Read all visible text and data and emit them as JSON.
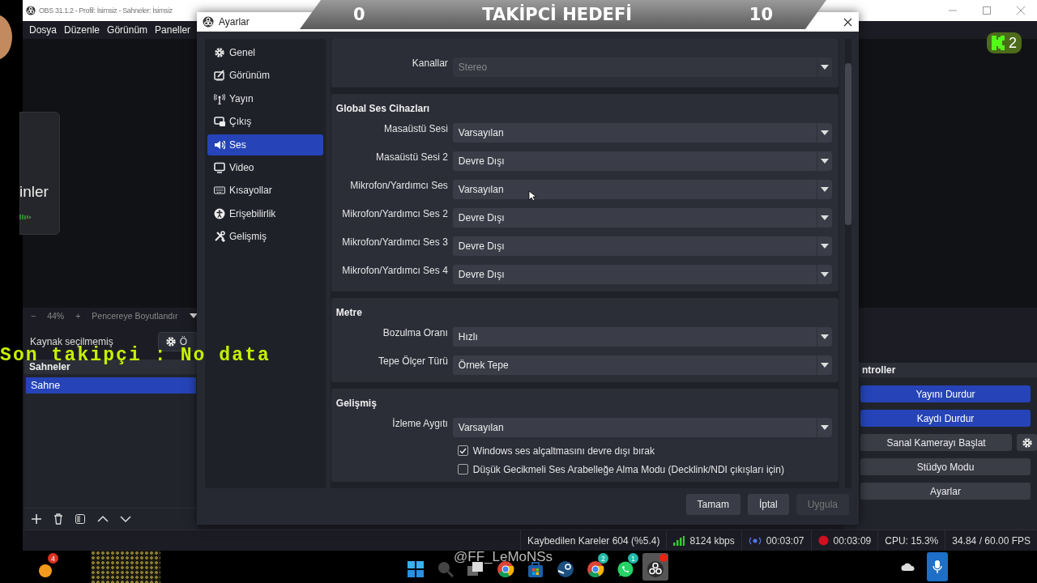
{
  "main_window": {
    "title": "OBS 31.1.2 - Profil: İsimsiz - Sahneler: İsimsiz",
    "menu": [
      "Dosya",
      "Düzenle",
      "Görünüm",
      "Paneller"
    ],
    "zoom_bar": {
      "minus": "−",
      "zoom": "44%",
      "plus": "+",
      "fit": "Pencereye Boyutlandır"
    },
    "source_bar": {
      "text": "Kaynak seçilmemiş",
      "button": "Ö"
    },
    "scenes": {
      "title": "Sahneler",
      "items": [
        {
          "label": "Sahne",
          "selected": true
        }
      ]
    },
    "controls": {
      "title": "ntroller",
      "buttons": [
        {
          "label": "Yayını Durdur",
          "active": true
        },
        {
          "label": "Kaydı Durdur",
          "active": true
        },
        {
          "label": "Sanal Kamerayı Başlat",
          "active": false
        },
        {
          "label": "Stüdyo Modu",
          "active": false
        },
        {
          "label": "Ayarlar",
          "active": false
        }
      ]
    },
    "status_bar": [
      {
        "kind": "plain",
        "text": "Kaybedilen Kareler 604 (%5.4)"
      },
      {
        "kind": "signal",
        "text": "8124 kbps"
      },
      {
        "kind": "stream",
        "text": "00:03:07"
      },
      {
        "kind": "record",
        "text": "00:03:09"
      },
      {
        "kind": "plain",
        "text": "CPU: 15.3%"
      },
      {
        "kind": "plain",
        "text": "34.84 / 60.00 FPS"
      }
    ]
  },
  "dialog": {
    "title": "Ayarlar",
    "nav": [
      {
        "kind": "gear",
        "label": "Genel",
        "selected": false
      },
      {
        "kind": "appearance",
        "label": "Görünüm",
        "selected": false
      },
      {
        "kind": "antenna",
        "label": "Yayın",
        "selected": false
      },
      {
        "kind": "output",
        "label": "Çıkış",
        "selected": false
      },
      {
        "kind": "speaker",
        "label": "Ses",
        "selected": true
      },
      {
        "kind": "monitor",
        "label": "Video",
        "selected": false
      },
      {
        "kind": "keyboard",
        "label": "Kısayollar",
        "selected": false
      },
      {
        "kind": "accessibility",
        "label": "Erişebilirlik",
        "selected": false
      },
      {
        "kind": "tools",
        "label": "Gelişmiş",
        "selected": false
      }
    ],
    "sections": [
      {
        "rows": [
          {
            "kind": "select",
            "label": "Kanallar",
            "value": "Stereo",
            "disabled": true
          }
        ]
      },
      {
        "title": "Global Ses Cihazları",
        "rows": [
          {
            "kind": "select",
            "label": "Masaüstü Sesi",
            "value": "Varsayılan",
            "disabled": false
          },
          {
            "kind": "select",
            "label": "Masaüstü Sesi 2",
            "value": "Devre Dışı",
            "disabled": false
          },
          {
            "kind": "select",
            "label": "Mikrofon/Yardımcı Ses",
            "value": "Varsayılan",
            "disabled": false
          },
          {
            "kind": "select",
            "label": "Mikrofon/Yardımcı Ses 2",
            "value": "Devre Dışı",
            "disabled": false
          },
          {
            "kind": "select",
            "label": "Mikrofon/Yardımcı Ses 3",
            "value": "Devre Dışı",
            "disabled": false
          },
          {
            "kind": "select",
            "label": "Mikrofon/Yardımcı Ses 4",
            "value": "Devre Dışı",
            "disabled": false
          }
        ]
      },
      {
        "title": "Metre",
        "rows": [
          {
            "kind": "select",
            "label": "Bozulma Oranı",
            "value": "Hızlı",
            "disabled": false
          },
          {
            "kind": "select",
            "label": "Tepe Ölçer Türü",
            "value": "Örnek Tepe",
            "disabled": false
          }
        ]
      },
      {
        "title": "Gelişmiş",
        "rows": [
          {
            "kind": "select",
            "label": "İzleme Aygıtı",
            "value": "Varsayılan",
            "disabled": false
          },
          {
            "kind": "checkbox",
            "label": "Windows ses alçaltmasını devre dışı bırak",
            "checked": true
          },
          {
            "kind": "checkbox",
            "label": "Düşük Gecikmeli Ses Arabelleğe Alma Modu (Decklink/NDI çıkışları için)",
            "checked": false
          }
        ]
      }
    ],
    "buttons": [
      {
        "label": "Tamam",
        "disabled": false
      },
      {
        "label": "İptal",
        "disabled": false
      },
      {
        "label": "Uygula",
        "disabled": true
      }
    ]
  },
  "overlays": {
    "goal": {
      "start": "0",
      "title": "TAKİPCİ HEDEFİ",
      "target": "10"
    },
    "last_follower": "Son takipçi : No data",
    "kick_count": "2",
    "profile_name": "inler",
    "handle": "@FF_LeMoNSs"
  },
  "taskbar": {
    "apps": [
      {
        "kind": "start"
      },
      {
        "kind": "search"
      },
      {
        "kind": "taskview"
      },
      {
        "kind": "chrome"
      },
      {
        "kind": "store"
      },
      {
        "kind": "steam"
      },
      {
        "kind": "chrome",
        "badge": "2"
      },
      {
        "kind": "whatsapp",
        "badge": "1"
      },
      {
        "kind": "obs",
        "active": true
      }
    ],
    "weather_badge": "4"
  }
}
